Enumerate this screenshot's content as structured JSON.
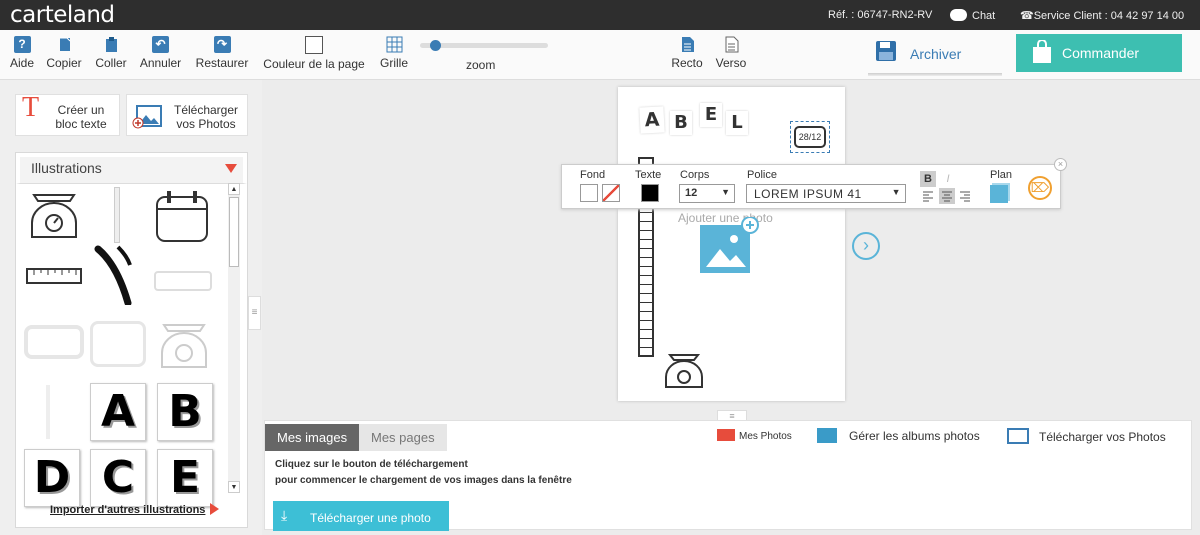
{
  "header": {
    "logo": "carteland",
    "ref": "Réf. : 06747-RN2-RV",
    "chat": "Chat",
    "service": "Service Client : 04 42 97 14 00"
  },
  "toolbar": {
    "aide": "Aide",
    "copier": "Copier",
    "coller": "Coller",
    "annuler": "Annuler",
    "restaurer": "Restaurer",
    "couleur": "Couleur de la page",
    "grille": "Grille",
    "zoom": "zoom",
    "zoom_value": 0.12,
    "recto": "Recto",
    "verso": "Verso",
    "archiver": "Archiver",
    "commander": "Commander"
  },
  "left": {
    "creer": "Créer un bloc texte",
    "telecharger": "Télécharger vos Photos",
    "illustrations": "Illustrations",
    "importer": "Importer d'autres illustrations",
    "letters": [
      "A",
      "B",
      "D",
      "C",
      "E"
    ]
  },
  "page": {
    "letters": [
      "A",
      "B",
      "E",
      "L"
    ],
    "calendar": "28/12",
    "add_photo": "Ajouter une photo"
  },
  "textbar": {
    "fond": "Fond",
    "texte": "Texte",
    "corps": "Corps",
    "corps_value": "12",
    "police": "Police",
    "police_value": "LOREM IPSUM 41",
    "bold": "B",
    "italic": "I",
    "plan": "Plan"
  },
  "bottom": {
    "tab_images": "Mes images",
    "tab_pages": "Mes pages",
    "mes_photos": "Mes Photos",
    "gerer": "Gérer les albums photos",
    "telecharger": "Télécharger vos Photos",
    "instruction1": "Cliquez sur le bouton de téléchargement",
    "instruction2": "pour commencer le chargement de vos images dans la fenêtre",
    "upload_button": "Télécharger une photo"
  },
  "colors": {
    "accent": "#3a7cb4",
    "commander": "#3dbfb1",
    "header": "#2e2e2e",
    "red": "#e74c3c"
  }
}
